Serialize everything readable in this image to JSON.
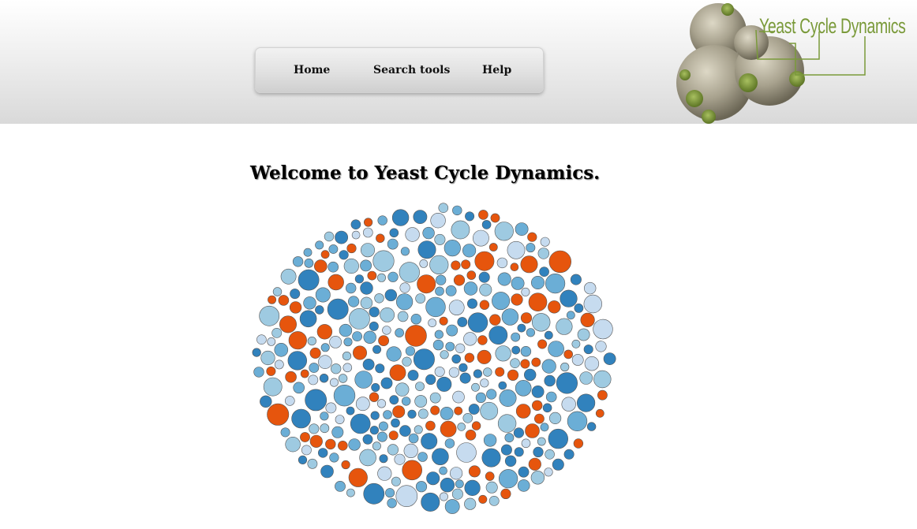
{
  "nav": {
    "home": "Home",
    "search_tools": "Search tools",
    "help": "Help"
  },
  "logo": {
    "text": "Yeast Cycle Dynamics",
    "icon": "yeast-cells-icon",
    "accent_color": "#7a9a3a"
  },
  "main": {
    "welcome": "Welcome to Yeast Cycle Dynamics."
  },
  "bubble_chart": {
    "type": "packed-circles",
    "colors": [
      "#e6550d",
      "#3182bd",
      "#6baed6",
      "#9ecae1",
      "#c6dbef"
    ],
    "stroke": "#555555"
  }
}
